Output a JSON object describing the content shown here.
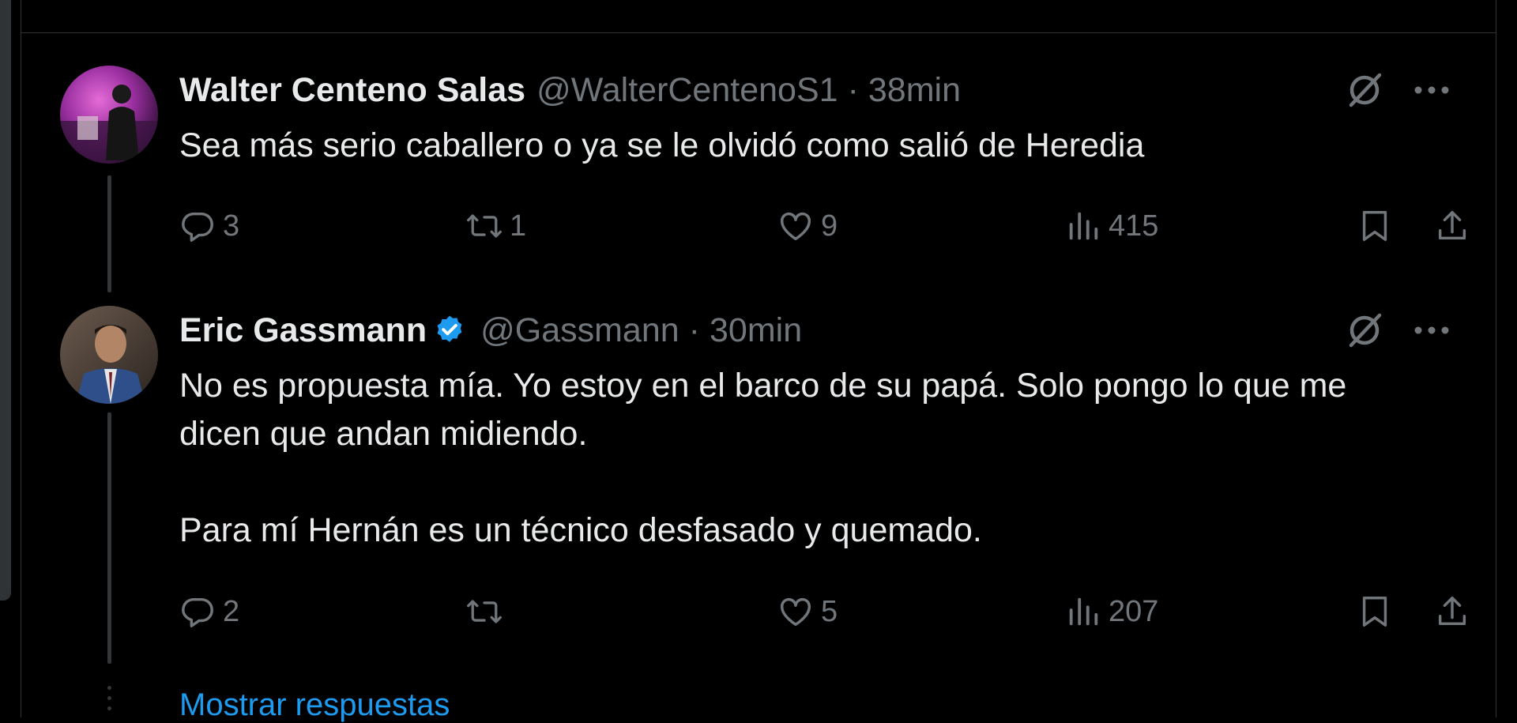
{
  "tweets": [
    {
      "name": "Walter Centeno Salas",
      "handle": "@WalterCentenoS1",
      "separator": "·",
      "time": "38min",
      "verified": false,
      "text": "Sea más serio caballero o ya se le olvidó como salió de Heredia",
      "replies": "3",
      "retweets": "1",
      "likes": "9",
      "views": "415"
    },
    {
      "name": "Eric Gassmann",
      "handle": "@Gassmann",
      "separator": "·",
      "time": "30min",
      "verified": true,
      "text": "No es propuesta mía. Yo estoy en el barco de su papá. Solo pongo lo que me dicen que andan midiendo.\n\nPara mí Hernán es un técnico desfasado y quemado.",
      "replies": "2",
      "retweets": "",
      "likes": "5",
      "views": "207"
    }
  ],
  "show_replies": "Mostrar respuestas",
  "icons": {
    "reply": "reply-icon",
    "retweet": "retweet-icon",
    "like": "heart-icon",
    "views": "views-icon",
    "bookmark": "bookmark-icon",
    "share": "share-icon",
    "grok": "grok-icon",
    "more": "more-icon",
    "verified": "verified-badge-icon"
  },
  "colors": {
    "background": "#000000",
    "text": "#e7e9ea",
    "muted": "#71767b",
    "link": "#1d9bf0",
    "border": "#2f3336"
  }
}
